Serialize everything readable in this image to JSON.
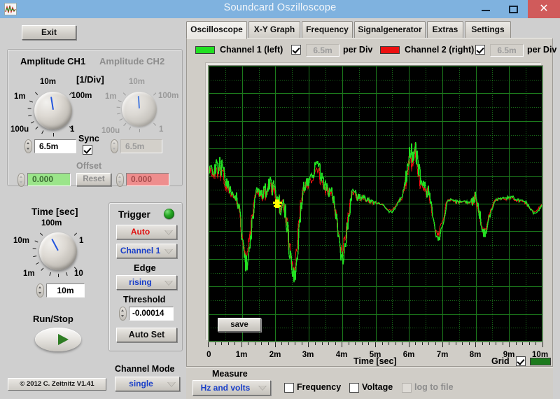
{
  "window": {
    "title": "Soundcard Oszilloscope",
    "icon": "oscilloscope-icon",
    "minimize": "–",
    "maximize": "□",
    "close": "✕"
  },
  "left": {
    "exit_label": "Exit",
    "amplitude": {
      "ch1_title": "Amplitude CH1",
      "ch2_title": "Amplitude CH2",
      "per_div_title": "[1/Div]",
      "ch1_ticks": [
        "1m",
        "10m",
        "100m",
        "100u",
        "1"
      ],
      "ch2_ticks": [
        "1m",
        "10m",
        "100m",
        "100u",
        "1"
      ],
      "ch1_value": "6.5m",
      "ch2_value": "6.5m",
      "sync_label": "Sync",
      "sync_checked": true,
      "offset_label": "Offset",
      "offset_ch1": "0.000",
      "offset_ch2": "0.000",
      "reset_label": "Reset"
    },
    "time": {
      "title": "Time [sec]",
      "ticks": [
        "100m",
        "10m",
        "1",
        "1m",
        "10"
      ],
      "value": "10m",
      "runstop_label": "Run/Stop"
    },
    "trigger": {
      "title": "Trigger",
      "led_color": "#25a522",
      "mode": "Auto",
      "mode_color": "#e01010",
      "source": "Channel 1",
      "source_color": "#1a3fc8",
      "edge_label": "Edge",
      "edge": "rising",
      "edge_color": "#1a3fc8",
      "threshold_label": "Threshold",
      "threshold_value": "-0.00014",
      "autoset_label": "Auto Set"
    },
    "channel_mode": {
      "label": "Channel Mode",
      "value": "single",
      "value_color": "#1a3fc8"
    },
    "copyright": "© 2012  C. Zeitnitz V1.41"
  },
  "tabs": [
    {
      "label": "Oscilloscope",
      "selected": true
    },
    {
      "label": "X-Y Graph",
      "selected": false
    },
    {
      "label": "Frequency",
      "selected": false
    },
    {
      "label": "Signalgenerator",
      "selected": false
    },
    {
      "label": "Extras",
      "selected": false
    },
    {
      "label": "Settings",
      "selected": false
    }
  ],
  "channels": [
    {
      "name": "Channel 1 (left)",
      "color": "#22e022",
      "enabled": true,
      "per_div_value": "6.5m",
      "per_div_label": "per Div"
    },
    {
      "name": "Channel 2 (right)",
      "color": "#ec1010",
      "enabled": true,
      "per_div_value": "6.5m",
      "per_div_label": "per Div"
    }
  ],
  "plot": {
    "save_label": "save",
    "grid_label": "Grid",
    "grid_checked": true,
    "grid_color": "#1c7a1c",
    "background": "#000000"
  },
  "measure": {
    "label": "Measure",
    "mode": "Hz and volts",
    "mode_color": "#1a3fc8",
    "frequency_label": "Frequency",
    "frequency_checked": false,
    "voltage_label": "Voltage",
    "voltage_checked": false,
    "log_label": "log to file",
    "log_checked": false,
    "log_disabled": true
  },
  "chart_data": {
    "type": "line",
    "title": "",
    "xlabel": "Time [sec]",
    "ylabel": "",
    "xlim": [
      0,
      0.01
    ],
    "ylim": [
      -0.0325,
      0.0325
    ],
    "x_tick_labels": [
      "0",
      "1m",
      "2m",
      "3m",
      "4m",
      "5m",
      "6m",
      "7m",
      "8m",
      "9m",
      "10m"
    ],
    "x_ticks": [
      0,
      0.001,
      0.002,
      0.003,
      0.004,
      0.005,
      0.006,
      0.007,
      0.008,
      0.009,
      0.01
    ],
    "x_divisions": 10,
    "y_divisions": 10,
    "volts_per_div": 0.0065,
    "sec_per_div": 0.001,
    "grid": true,
    "grid_minor": true,
    "legend": [
      "Channel 1 (left)",
      "Channel 2 (right)"
    ],
    "cursor": {
      "x": 0.00205,
      "y": 0.0,
      "color": "#ffff00"
    },
    "series": [
      {
        "name": "Channel 1 (left)",
        "color": "#22e022",
        "envelope": [
          [
            0.0,
            0.55
          ],
          [
            0.0002,
            0.58
          ],
          [
            0.0004,
            0.5
          ],
          [
            0.0006,
            0.4
          ],
          [
            0.0008,
            0.3
          ],
          [
            0.001,
            0.62
          ],
          [
            0.0012,
            0.52
          ],
          [
            0.0014,
            0.44
          ],
          [
            0.0016,
            0.38
          ],
          [
            0.0018,
            0.55
          ],
          [
            0.002,
            0.6
          ],
          [
            0.0022,
            0.52
          ],
          [
            0.0024,
            0.66
          ],
          [
            0.0026,
            0.58
          ],
          [
            0.0028,
            0.46
          ],
          [
            0.003,
            0.4
          ],
          [
            0.0032,
            0.52
          ],
          [
            0.0034,
            0.44
          ],
          [
            0.0036,
            0.36
          ],
          [
            0.0038,
            0.42
          ],
          [
            0.004,
            0.48
          ],
          [
            0.0042,
            0.4
          ],
          [
            0.0044,
            0.3
          ],
          [
            0.0046,
            0.22
          ],
          [
            0.0048,
            0.14
          ],
          [
            0.005,
            0.09
          ],
          [
            0.0052,
            0.07
          ],
          [
            0.0054,
            0.07
          ],
          [
            0.0056,
            0.08
          ],
          [
            0.0058,
            0.1
          ],
          [
            0.006,
            0.72
          ],
          [
            0.0062,
            0.8
          ],
          [
            0.0064,
            0.48
          ],
          [
            0.0066,
            0.4
          ],
          [
            0.0068,
            0.34
          ],
          [
            0.007,
            0.26
          ],
          [
            0.0072,
            0.16
          ],
          [
            0.0074,
            0.1
          ],
          [
            0.0076,
            0.08
          ],
          [
            0.0078,
            0.08
          ],
          [
            0.008,
            0.4
          ],
          [
            0.0082,
            0.42
          ],
          [
            0.0084,
            0.16
          ],
          [
            0.0086,
            0.1
          ],
          [
            0.0088,
            0.09
          ],
          [
            0.009,
            0.09
          ],
          [
            0.0092,
            0.1
          ],
          [
            0.0094,
            0.09
          ],
          [
            0.0096,
            0.08
          ],
          [
            0.0098,
            0.08
          ],
          [
            0.01,
            0.07
          ]
        ]
      },
      {
        "name": "Channel 2 (right)",
        "color": "#ec1010",
        "envelope": [
          [
            0.0,
            0.52
          ],
          [
            0.0002,
            0.54
          ],
          [
            0.0004,
            0.46
          ],
          [
            0.0006,
            0.37
          ],
          [
            0.0008,
            0.28
          ],
          [
            0.001,
            0.57
          ],
          [
            0.0012,
            0.48
          ],
          [
            0.0014,
            0.41
          ],
          [
            0.0016,
            0.35
          ],
          [
            0.0018,
            0.51
          ],
          [
            0.002,
            0.56
          ],
          [
            0.0022,
            0.48
          ],
          [
            0.0024,
            0.61
          ],
          [
            0.0026,
            0.54
          ],
          [
            0.0028,
            0.43
          ],
          [
            0.003,
            0.37
          ],
          [
            0.0032,
            0.48
          ],
          [
            0.0034,
            0.41
          ],
          [
            0.0036,
            0.33
          ],
          [
            0.0038,
            0.39
          ],
          [
            0.004,
            0.44
          ],
          [
            0.0042,
            0.37
          ],
          [
            0.0044,
            0.28
          ],
          [
            0.0046,
            0.2
          ],
          [
            0.0048,
            0.13
          ],
          [
            0.005,
            0.08
          ],
          [
            0.0052,
            0.06
          ],
          [
            0.0054,
            0.06
          ],
          [
            0.0056,
            0.07
          ],
          [
            0.0058,
            0.09
          ],
          [
            0.006,
            0.66
          ],
          [
            0.0062,
            0.74
          ],
          [
            0.0064,
            0.44
          ],
          [
            0.0066,
            0.37
          ],
          [
            0.0068,
            0.31
          ],
          [
            0.007,
            0.24
          ],
          [
            0.0072,
            0.15
          ],
          [
            0.0074,
            0.09
          ],
          [
            0.0076,
            0.07
          ],
          [
            0.0078,
            0.07
          ],
          [
            0.008,
            0.37
          ],
          [
            0.0082,
            0.39
          ],
          [
            0.0084,
            0.15
          ],
          [
            0.0086,
            0.09
          ],
          [
            0.0088,
            0.08
          ],
          [
            0.009,
            0.08
          ],
          [
            0.0092,
            0.09
          ],
          [
            0.0094,
            0.08
          ],
          [
            0.0096,
            0.07
          ],
          [
            0.0098,
            0.07
          ],
          [
            0.01,
            0.06
          ]
        ]
      }
    ]
  }
}
